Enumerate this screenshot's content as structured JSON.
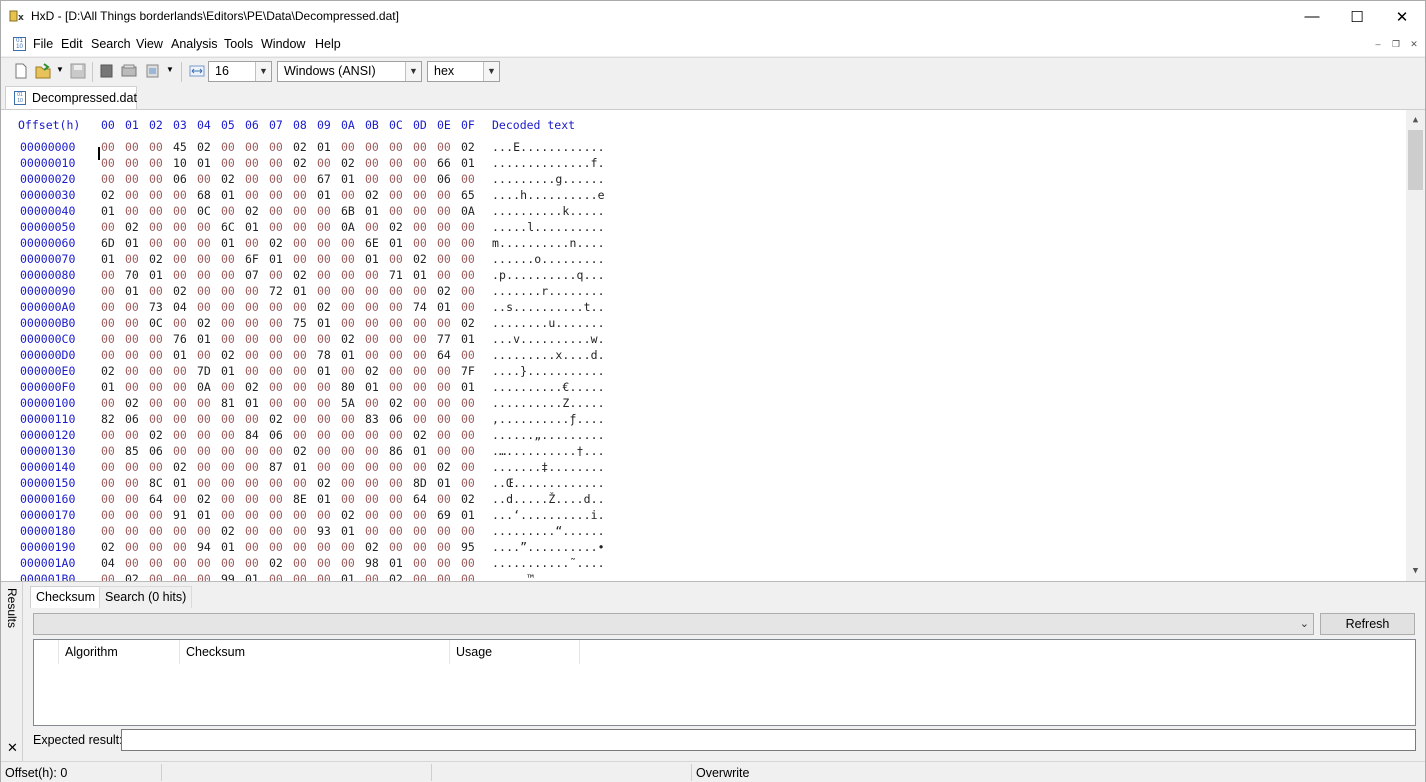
{
  "window": {
    "app_icon": "hxd-icon",
    "title": "HxD - [D:\\All Things borderlands\\Editors\\PE\\Data\\Decompressed.dat]",
    "minimize": "—",
    "maximize": "☐",
    "close": "✕"
  },
  "menu": {
    "items": [
      "File",
      "Edit",
      "Search",
      "View",
      "Analysis",
      "Tools",
      "Window",
      "Help"
    ],
    "mdi_minimize": "–",
    "mdi_restore": "❐",
    "mdi_close": "✕"
  },
  "toolbar": {
    "bytes_per_row": "16",
    "charset": "Windows (ANSI)",
    "offset_base": "hex"
  },
  "document_tab": "Decompressed.dat",
  "hex": {
    "header_offset": "Offset(h)",
    "header_columns": [
      "00",
      "01",
      "02",
      "03",
      "04",
      "05",
      "06",
      "07",
      "08",
      "09",
      "0A",
      "0B",
      "0C",
      "0D",
      "0E",
      "0F"
    ],
    "header_decoded": "Decoded text",
    "rows": [
      {
        "offset": "00000000",
        "bytes": [
          "00",
          "00",
          "00",
          "45",
          "02",
          "00",
          "00",
          "00",
          "02",
          "01",
          "00",
          "00",
          "00",
          "00",
          "00",
          "02"
        ],
        "text": "...E............"
      },
      {
        "offset": "00000010",
        "bytes": [
          "00",
          "00",
          "00",
          "10",
          "01",
          "00",
          "00",
          "00",
          "02",
          "00",
          "02",
          "00",
          "00",
          "00",
          "66",
          "01"
        ],
        "text": "..............f."
      },
      {
        "offset": "00000020",
        "bytes": [
          "00",
          "00",
          "00",
          "06",
          "00",
          "02",
          "00",
          "00",
          "00",
          "67",
          "01",
          "00",
          "00",
          "00",
          "06",
          "00"
        ],
        "text": ".........g......"
      },
      {
        "offset": "00000030",
        "bytes": [
          "02",
          "00",
          "00",
          "00",
          "68",
          "01",
          "00",
          "00",
          "00",
          "01",
          "00",
          "02",
          "00",
          "00",
          "00",
          "65"
        ],
        "text": "....h..........e"
      },
      {
        "offset": "00000040",
        "bytes": [
          "01",
          "00",
          "00",
          "00",
          "0C",
          "00",
          "02",
          "00",
          "00",
          "00",
          "6B",
          "01",
          "00",
          "00",
          "00",
          "0A"
        ],
        "text": "..........k....."
      },
      {
        "offset": "00000050",
        "bytes": [
          "00",
          "02",
          "00",
          "00",
          "00",
          "6C",
          "01",
          "00",
          "00",
          "00",
          "0A",
          "00",
          "02",
          "00",
          "00",
          "00"
        ],
        "text": ".....l.........."
      },
      {
        "offset": "00000060",
        "bytes": [
          "6D",
          "01",
          "00",
          "00",
          "00",
          "01",
          "00",
          "02",
          "00",
          "00",
          "00",
          "6E",
          "01",
          "00",
          "00",
          "00"
        ],
        "text": "m..........n...."
      },
      {
        "offset": "00000070",
        "bytes": [
          "01",
          "00",
          "02",
          "00",
          "00",
          "00",
          "6F",
          "01",
          "00",
          "00",
          "00",
          "01",
          "00",
          "02",
          "00",
          "00"
        ],
        "text": "......o........."
      },
      {
        "offset": "00000080",
        "bytes": [
          "00",
          "70",
          "01",
          "00",
          "00",
          "00",
          "07",
          "00",
          "02",
          "00",
          "00",
          "00",
          "71",
          "01",
          "00",
          "00"
        ],
        "text": ".p..........q..."
      },
      {
        "offset": "00000090",
        "bytes": [
          "00",
          "01",
          "00",
          "02",
          "00",
          "00",
          "00",
          "72",
          "01",
          "00",
          "00",
          "00",
          "00",
          "00",
          "02",
          "00"
        ],
        "text": ".......r........"
      },
      {
        "offset": "000000A0",
        "bytes": [
          "00",
          "00",
          "73",
          "04",
          "00",
          "00",
          "00",
          "00",
          "00",
          "02",
          "00",
          "00",
          "00",
          "74",
          "01",
          "00"
        ],
        "text": "..s..........t.."
      },
      {
        "offset": "000000B0",
        "bytes": [
          "00",
          "00",
          "0C",
          "00",
          "02",
          "00",
          "00",
          "00",
          "75",
          "01",
          "00",
          "00",
          "00",
          "00",
          "00",
          "02"
        ],
        "text": "........u......."
      },
      {
        "offset": "000000C0",
        "bytes": [
          "00",
          "00",
          "00",
          "76",
          "01",
          "00",
          "00",
          "00",
          "00",
          "00",
          "02",
          "00",
          "00",
          "00",
          "77",
          "01"
        ],
        "text": "...v..........w."
      },
      {
        "offset": "000000D0",
        "bytes": [
          "00",
          "00",
          "00",
          "01",
          "00",
          "02",
          "00",
          "00",
          "00",
          "78",
          "01",
          "00",
          "00",
          "00",
          "64",
          "00"
        ],
        "text": ".........x....d."
      },
      {
        "offset": "000000E0",
        "bytes": [
          "02",
          "00",
          "00",
          "00",
          "7D",
          "01",
          "00",
          "00",
          "00",
          "01",
          "00",
          "02",
          "00",
          "00",
          "00",
          "7F"
        ],
        "text": "....}..........."
      },
      {
        "offset": "000000F0",
        "bytes": [
          "01",
          "00",
          "00",
          "00",
          "0A",
          "00",
          "02",
          "00",
          "00",
          "00",
          "80",
          "01",
          "00",
          "00",
          "00",
          "01"
        ],
        "text": "..........€....."
      },
      {
        "offset": "00000100",
        "bytes": [
          "00",
          "02",
          "00",
          "00",
          "00",
          "81",
          "01",
          "00",
          "00",
          "00",
          "5A",
          "00",
          "02",
          "00",
          "00",
          "00"
        ],
        "text": "..........Z....."
      },
      {
        "offset": "00000110",
        "bytes": [
          "82",
          "06",
          "00",
          "00",
          "00",
          "00",
          "00",
          "02",
          "00",
          "00",
          "00",
          "83",
          "06",
          "00",
          "00",
          "00"
        ],
        "text": "‚..........ƒ...."
      },
      {
        "offset": "00000120",
        "bytes": [
          "00",
          "00",
          "02",
          "00",
          "00",
          "00",
          "84",
          "06",
          "00",
          "00",
          "00",
          "00",
          "00",
          "02",
          "00",
          "00"
        ],
        "text": "......„........."
      },
      {
        "offset": "00000130",
        "bytes": [
          "00",
          "85",
          "06",
          "00",
          "00",
          "00",
          "00",
          "00",
          "02",
          "00",
          "00",
          "00",
          "86",
          "01",
          "00",
          "00"
        ],
        "text": ".…..........†..."
      },
      {
        "offset": "00000140",
        "bytes": [
          "00",
          "00",
          "00",
          "02",
          "00",
          "00",
          "00",
          "87",
          "01",
          "00",
          "00",
          "00",
          "00",
          "00",
          "02",
          "00"
        ],
        "text": ".......‡........"
      },
      {
        "offset": "00000150",
        "bytes": [
          "00",
          "00",
          "8C",
          "01",
          "00",
          "00",
          "00",
          "00",
          "00",
          "02",
          "00",
          "00",
          "00",
          "8D",
          "01",
          "00"
        ],
        "text": "..Œ............."
      },
      {
        "offset": "00000160",
        "bytes": [
          "00",
          "00",
          "64",
          "00",
          "02",
          "00",
          "00",
          "00",
          "8E",
          "01",
          "00",
          "00",
          "00",
          "64",
          "00",
          "02"
        ],
        "text": "..d.....Ž....d.."
      },
      {
        "offset": "00000170",
        "bytes": [
          "00",
          "00",
          "00",
          "91",
          "01",
          "00",
          "00",
          "00",
          "00",
          "00",
          "02",
          "00",
          "00",
          "00",
          "69",
          "01"
        ],
        "text": "...‘..........i."
      },
      {
        "offset": "00000180",
        "bytes": [
          "00",
          "00",
          "00",
          "00",
          "00",
          "02",
          "00",
          "00",
          "00",
          "93",
          "01",
          "00",
          "00",
          "00",
          "00",
          "00"
        ],
        "text": ".........“......"
      },
      {
        "offset": "00000190",
        "bytes": [
          "02",
          "00",
          "00",
          "00",
          "94",
          "01",
          "00",
          "00",
          "00",
          "00",
          "00",
          "02",
          "00",
          "00",
          "00",
          "95"
        ],
        "text": "....”..........•"
      },
      {
        "offset": "000001A0",
        "bytes": [
          "04",
          "00",
          "00",
          "00",
          "00",
          "00",
          "00",
          "02",
          "00",
          "00",
          "00",
          "98",
          "01",
          "00",
          "00",
          "00"
        ],
        "text": "...........˜...."
      },
      {
        "offset": "000001B0",
        "bytes": [
          "00",
          "02",
          "00",
          "00",
          "00",
          "99",
          "01",
          "00",
          "00",
          "00",
          "01",
          "00",
          "02",
          "00",
          "00",
          "00"
        ],
        "text": ".....™.........."
      }
    ]
  },
  "results": {
    "side_label": "Results",
    "close": "✕",
    "tabs": [
      "Checksum",
      "Search (0 hits)"
    ],
    "refresh_label": "Refresh",
    "columns": [
      "Algorithm",
      "Checksum",
      "Usage"
    ],
    "expected_label": "Expected result:"
  },
  "status": {
    "offset": "Offset(h): 0",
    "mode": "Overwrite"
  }
}
